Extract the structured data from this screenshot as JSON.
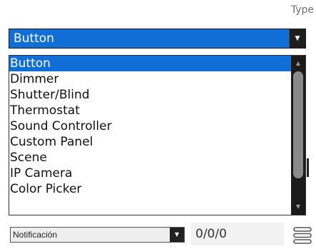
{
  "header": {
    "type_label": "Type"
  },
  "type_select": {
    "selected_value": "Button",
    "arrow_icon": "triangle-down-icon",
    "accent_color": "#0f6fd6"
  },
  "dropdown": {
    "options": [
      {
        "label": "Button",
        "selected": true
      },
      {
        "label": "Dimmer",
        "selected": false
      },
      {
        "label": "Shutter/Blind",
        "selected": false
      },
      {
        "label": "Thermostat",
        "selected": false
      },
      {
        "label": "Sound Controller",
        "selected": false
      },
      {
        "label": "Custom Panel",
        "selected": false
      },
      {
        "label": "Scene",
        "selected": false
      },
      {
        "label": "IP Camera",
        "selected": false
      },
      {
        "label": "Color Picker",
        "selected": false
      }
    ],
    "scroll_up_icon": "triangle-up-icon",
    "scroll_down_icon": "triangle-down-icon"
  },
  "bottom_row": {
    "notification_select_value": "Notificación",
    "address_value": "0/0/0",
    "menu_icon": "hamburger-menu-icon"
  }
}
